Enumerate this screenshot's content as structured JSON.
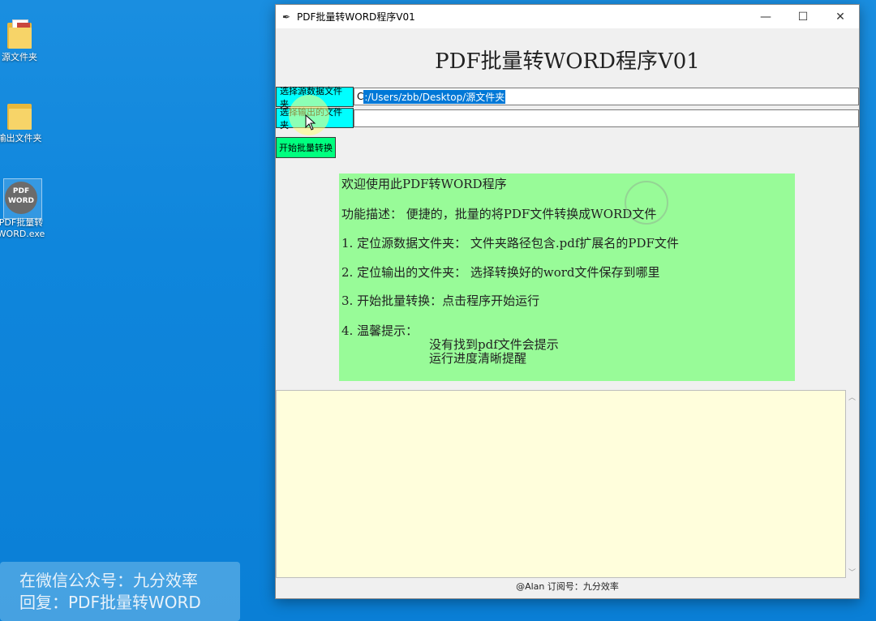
{
  "desktop": {
    "icons": [
      {
        "label": "源文件夹"
      },
      {
        "label": "输出文件夹"
      },
      {
        "label_line1": "PDF批量转",
        "label_line2": "WORD.exe",
        "glyph_top": "PDF",
        "glyph_bottom": "WORD"
      }
    ]
  },
  "watermark": {
    "line1": "在微信公众号：九分效率",
    "line2": "回复：PDF批量转WORD"
  },
  "window": {
    "title": "PDF批量转WORD程序V01",
    "controls": {
      "minimize": "—",
      "maximize": "☐",
      "close": "✕"
    },
    "app_title": "PDF批量转WORD程序V01",
    "source_button": "选择源数据文件夹",
    "source_path": "C:/Users/zbb/Desktop/源文件夹",
    "source_path_prefix": "C",
    "source_path_selected": ":/Users/zbb/Desktop/源文件夹",
    "output_button": "选择输出的文件夹",
    "output_path": "",
    "start_button": "开始批量转换",
    "info": {
      "welcome": "欢迎使用此PDF转WORD程序",
      "desc": "功能描述：  便捷的，批量的将PDF文件转换成WORD文件",
      "step1": "1.  定位源数据文件夹：  文件夹路径包含.pdf扩展名的PDF文件",
      "step2": "2.  定位输出的文件夹：  选择转换好的word文件保存到哪里",
      "step3": "3.  开始批量转换：点击程序开始运行",
      "step4": "4.  温馨提示：",
      "tip1": "没有找到pdf文件会提示",
      "tip2": "运行进度清晰提醒"
    },
    "footer": "@Alan  订阅号：九分效率"
  }
}
